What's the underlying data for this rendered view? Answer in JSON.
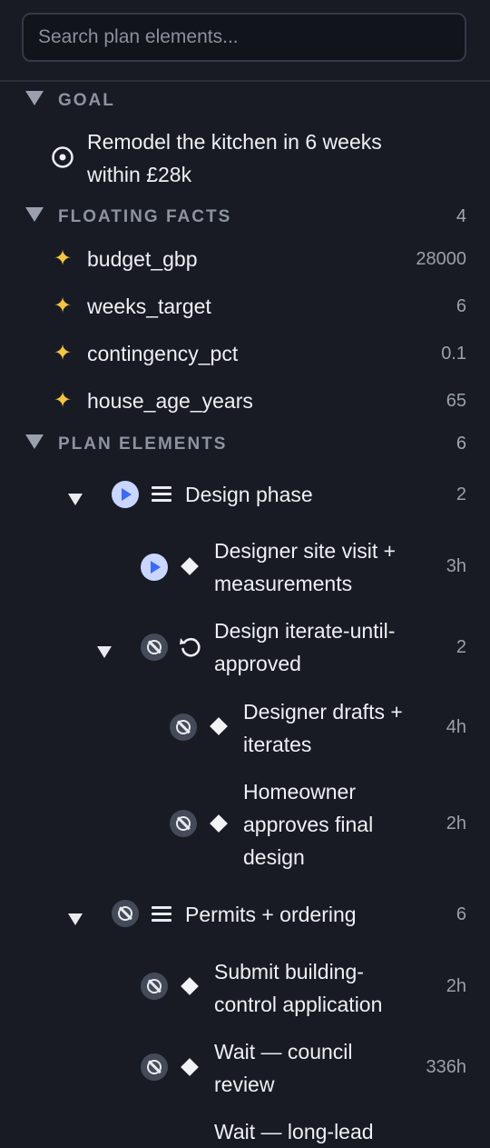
{
  "search": {
    "placeholder": "Search plan elements..."
  },
  "goal": {
    "header": "GOAL",
    "text_line1": "Remodel the kitchen in 6 weeks",
    "text_line2": "within £28k"
  },
  "facts": {
    "header": "FLOATING FACTS",
    "count": "4",
    "items": [
      {
        "name": "budget_gbp",
        "value": "28000",
        "icon": "sparkle-icon"
      },
      {
        "name": "weeks_target",
        "value": "6",
        "icon": "sparkle-icon"
      },
      {
        "name": "contingency_pct",
        "value": "0.1",
        "icon": "sparkle-icon"
      },
      {
        "name": "house_age_years",
        "value": "65",
        "icon": "sparkle-icon"
      }
    ]
  },
  "plan": {
    "header": "PLAN ELEMENTS",
    "count": "6",
    "items": [
      {
        "title": "Design phase",
        "value": "2",
        "status": "running",
        "kind": "sequence"
      },
      {
        "line1": "Designer site visit +",
        "line2": "measurements",
        "value": "3h",
        "status": "running",
        "kind": "task"
      },
      {
        "line1": "Design iterate-until-",
        "line2": "approved",
        "value": "2",
        "status": "blocked",
        "kind": "loop"
      },
      {
        "line1": "Designer drafts +",
        "line2": "iterates",
        "value": "4h",
        "status": "blocked",
        "kind": "task"
      },
      {
        "line1": "Homeowner",
        "line2": "approves final",
        "line3": "design",
        "value": "2h",
        "status": "blocked",
        "kind": "task"
      },
      {
        "title": "Permits + ordering",
        "value": "6",
        "status": "blocked",
        "kind": "sequence"
      },
      {
        "line1": "Submit building-",
        "line2": "control application",
        "value": "2h",
        "status": "blocked",
        "kind": "task"
      },
      {
        "line1": "Wait — council",
        "line2": "review",
        "value": "336h",
        "status": "blocked",
        "kind": "task"
      },
      {
        "line1": "Wait — long-lead",
        "value": "",
        "status": "blocked",
        "kind": "task"
      }
    ]
  },
  "colors": {
    "background": "#181b24",
    "accent_running": "#3d6bf0",
    "fact_star": "#f4c542"
  }
}
